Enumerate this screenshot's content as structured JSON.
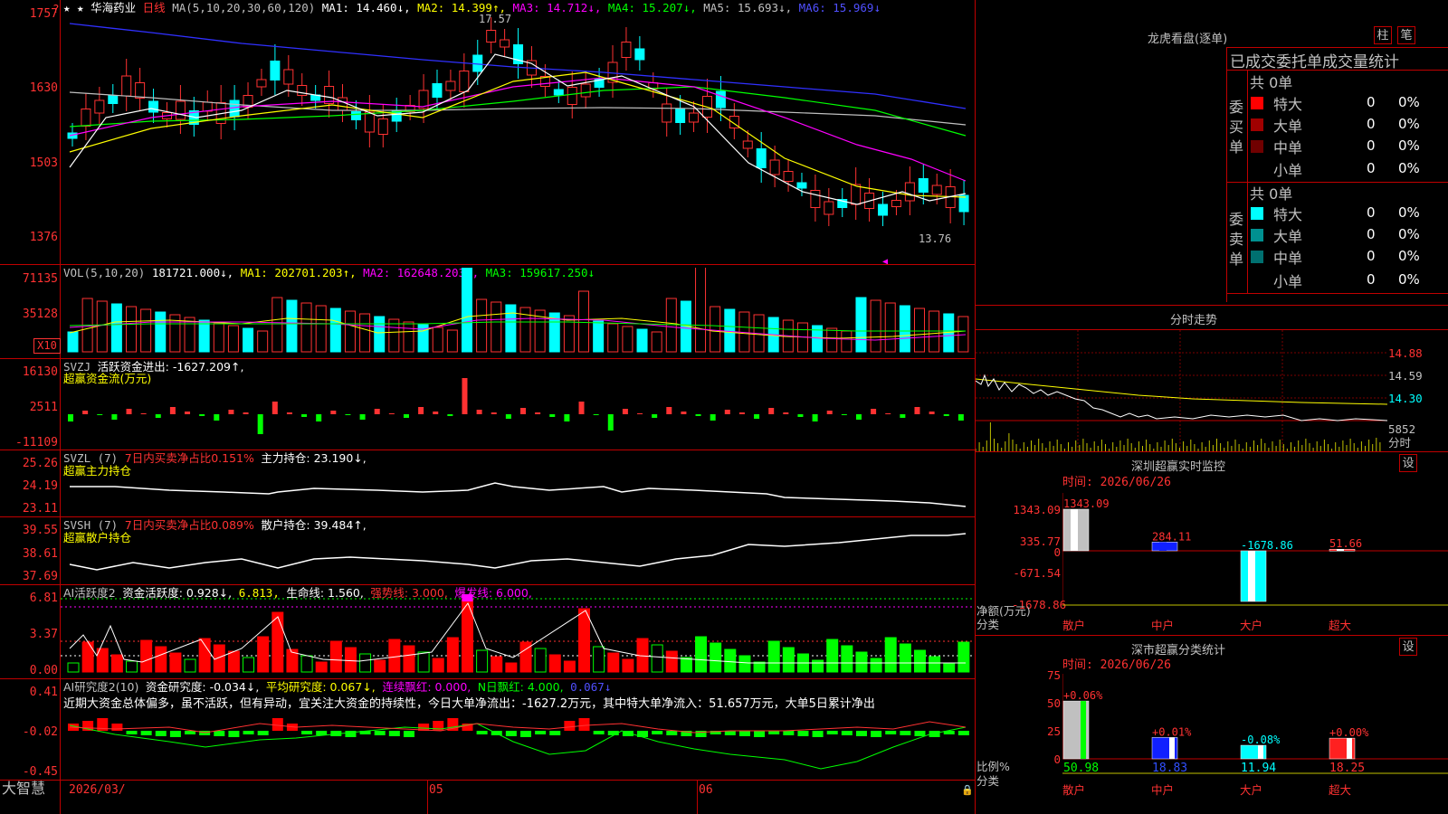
{
  "stock": {
    "marker": "★ ★",
    "name": "华海药业",
    "period": "日线"
  },
  "ma_header": {
    "ma": "MA(5,10,20,30,60,120)",
    "ma1": "MA1: 14.460↓,",
    "ma2": "MA2: 14.399↑,",
    "ma3": "MA3: 14.712↓,",
    "ma4": "MA4: 15.207↓,",
    "ma5": "MA5: 15.693↓,",
    "ma6": "MA6: 15.969↓"
  },
  "price_axis": [
    "1757",
    "1630",
    "1503",
    "1376"
  ],
  "price_annotations": {
    "high": "17.57",
    "low": "13.76"
  },
  "vol_header": {
    "vol": "VOL(5,10,20)",
    "val": "181721.000↓,",
    "ma1": "MA1: 202701.203↑,",
    "ma2": "MA2: 162648.203↑,",
    "ma3": "MA3: 159617.250↓"
  },
  "vol_axis": [
    "71135",
    "35128"
  ],
  "vol_unit": "X10",
  "svzj": {
    "name": "SVZJ",
    "label": "活跃资金进出: -1627.209↑,",
    "sub": "超赢资金流(万元)",
    "axis": [
      "16130",
      "2511",
      "-11109"
    ]
  },
  "svzl": {
    "name": "SVZL (7)",
    "label1": "7日内买卖净占比0.151%",
    "label2": "主力持仓: 23.190↓,",
    "sub": "超赢主力持仓",
    "axis": [
      "25.26",
      "24.19",
      "23.11"
    ]
  },
  "svsh": {
    "name": "SVSH (7)",
    "label1": "7日内买卖净占比0.089%",
    "label2": "散户持仓: 39.484↑,",
    "sub": "超赢散户持仓",
    "axis": [
      "39.55",
      "38.61",
      "37.69"
    ]
  },
  "ai2": {
    "name": "AI活跃度2",
    "l1": "资金活跃度: 0.928↓,",
    "l2": "6.813,",
    "l3": "生命线: 1.560,",
    "l4": "强势线: 3.000,",
    "l5": "爆发线: 6.000,",
    "axis": [
      "6.81",
      "3.37",
      "0.00"
    ]
  },
  "ai3": {
    "name": "AI研究度2(10)",
    "l1": "资金研究度: -0.034↓,",
    "l2": "平均研究度: 0.067↓,",
    "l3": "连续飘红: 0.000,",
    "l4": "N日飘红: 4.000,",
    "l5": "0.067↓",
    "comment": "近期大资金总体偏多，虽不活跃，但有异动，宜关注大资金的持续性，今日大单净流出：-1627.2万元，其中特大单净流入：51.657万元，大单5日累计净出",
    "axis": [
      "0.41",
      "-0.02",
      "-0.45"
    ]
  },
  "date_axis": {
    "d1": "2026/03/",
    "d2": "05",
    "d3": "06"
  },
  "brand": "大智慧",
  "longhu": {
    "title": "龙虎看盘(逐单)",
    "btn_zhu": "柱",
    "btn_bi": "笔",
    "subtitle": "已成交委托单成交量统计",
    "buy": {
      "label": "委买单",
      "total": "共 0单",
      "rows": [
        {
          "name": "特大",
          "qty": "0",
          "pct": "0%",
          "color": "#ff0000"
        },
        {
          "name": "大单",
          "qty": "0",
          "pct": "0%",
          "color": "#a00000"
        },
        {
          "name": "中单",
          "qty": "0",
          "pct": "0%",
          "color": "#700000"
        },
        {
          "name": "小单",
          "qty": "0",
          "pct": "0%",
          "color": "#000000"
        }
      ]
    },
    "sell": {
      "label": "委卖单",
      "total": "共 0单",
      "rows": [
        {
          "name": "特大",
          "qty": "0",
          "pct": "0%",
          "color": "#00ffff"
        },
        {
          "name": "大单",
          "qty": "0",
          "pct": "0%",
          "color": "#009090"
        },
        {
          "name": "中单",
          "qty": "0",
          "pct": "0%",
          "color": "#007070"
        },
        {
          "name": "小单",
          "qty": "0",
          "pct": "0%",
          "color": "#000000"
        }
      ]
    }
  },
  "fenshi": {
    "title": "分时走势",
    "axis": [
      "14.88",
      "14.59",
      "14.30"
    ],
    "vol": "5852",
    "unit": "分时"
  },
  "szmon": {
    "title": "深圳超赢实时监控",
    "btn": "设",
    "time": "时间: 2026/06/26",
    "axis": [
      "1343.09",
      "335.77",
      "0",
      "-671.54",
      "-1678.86"
    ],
    "ylabel": "净额(万元)",
    "xlabel": "分类",
    "chart_data": {
      "type": "bar",
      "categories": [
        "散户",
        "中户",
        "大户",
        "超大"
      ],
      "values": [
        1343.09,
        284.11,
        -1678.86,
        51.66
      ],
      "ylim": [
        -1678.86,
        1343.09
      ]
    },
    "value_labels": [
      "1343.09",
      "284.11",
      "-1678.86",
      "51.66"
    ]
  },
  "szcls": {
    "title": "深市超赢分类统计",
    "btn": "设",
    "time": "时间: 2026/06/26",
    "axis": [
      "75",
      "50",
      "25",
      "0"
    ],
    "ylabel": "比例%",
    "xlabel": "分类",
    "chart_data": {
      "type": "bar",
      "categories": [
        "散户",
        "中户",
        "大户",
        "超大"
      ],
      "values": [
        50.98,
        18.83,
        11.94,
        18.25
      ],
      "changes": [
        "+0.06%",
        "+0.01%",
        "-0.08%",
        "+0.00%"
      ],
      "ylim": [
        0,
        75
      ]
    },
    "value_labels": [
      "50.98",
      "18.83",
      "11.94",
      "18.25"
    ]
  }
}
